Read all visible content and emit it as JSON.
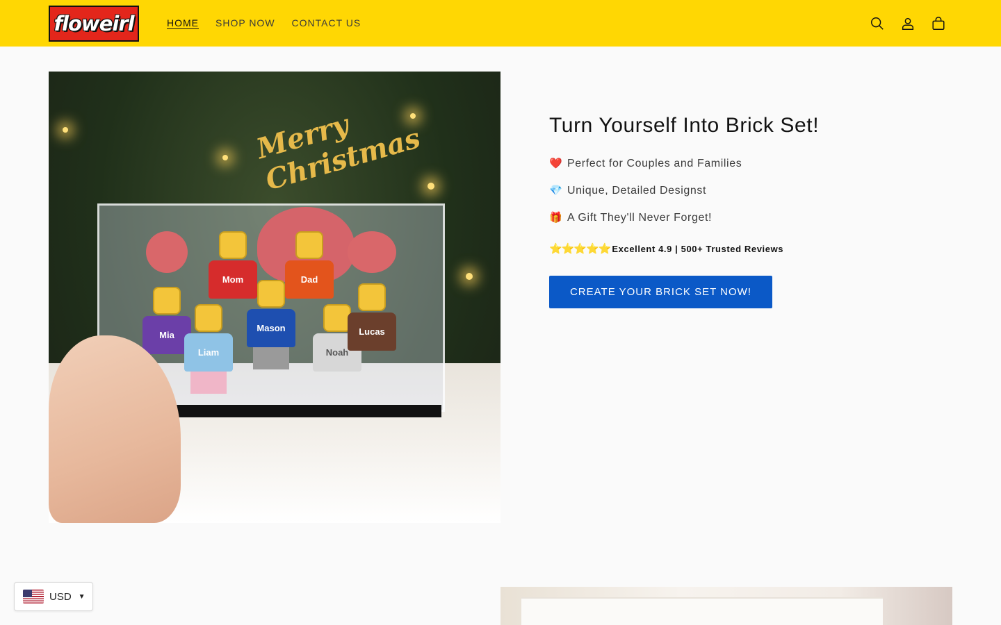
{
  "header": {
    "logo_text": "floweirl",
    "nav": [
      {
        "label": "HOME",
        "active": true
      },
      {
        "label": "SHOP NOW",
        "active": false
      },
      {
        "label": "CONTACT US",
        "active": false
      }
    ],
    "icons": [
      "search-icon",
      "account-icon",
      "cart-icon"
    ],
    "background_color": "#ffd703"
  },
  "hero": {
    "image_text": {
      "decoration": "Merry Christmas",
      "figures": [
        "Mom",
        "Dad",
        "Mia",
        "Liam",
        "Mason",
        "Noah",
        "Lucas"
      ]
    },
    "title": "Turn Yourself Into Brick Set!",
    "bullets": [
      {
        "emoji": "❤️",
        "text": "Perfect for Couples and Families"
      },
      {
        "emoji": "💎",
        "text": "Unique, Detailed Designst"
      },
      {
        "emoji": "🎁",
        "text": "A Gift They'll Never Forget!"
      }
    ],
    "rating": {
      "stars": "⭐⭐⭐⭐⭐",
      "text": "Excellent 4.9 | 500+ Trusted Reviews"
    },
    "cta_label": "CREATE YOUR BRICK SET NOW!",
    "cta_color": "#0b59c7"
  },
  "currency": {
    "code": "USD",
    "flag": "us-flag-icon"
  }
}
